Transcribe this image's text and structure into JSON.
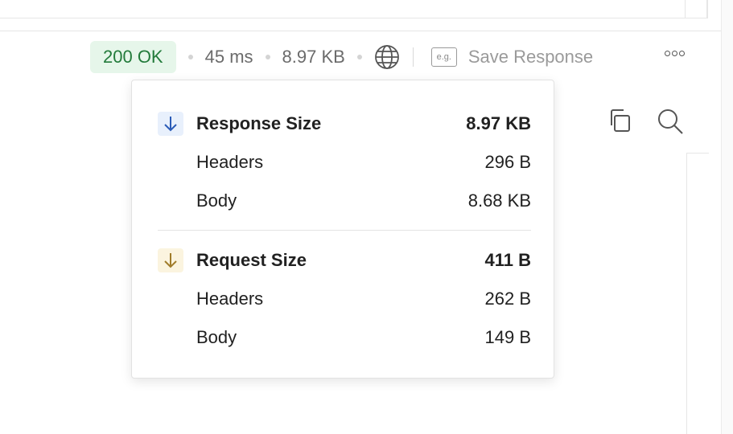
{
  "status": {
    "code_text": "200 OK",
    "time": "45 ms",
    "size": "8.97 KB"
  },
  "save_response": {
    "icon_text": "e.g.",
    "label": "Save Response"
  },
  "colors": {
    "success_bg": "#e6f6ea",
    "success_text": "#237b3b",
    "response_icon": "#2a5bb7",
    "request_icon": "#a07c2a"
  },
  "popover": {
    "response": {
      "title": "Response Size",
      "total": "8.97 KB",
      "headers_label": "Headers",
      "headers_value": "296 B",
      "body_label": "Body",
      "body_value": "8.68 KB"
    },
    "request": {
      "title": "Request Size",
      "total": "411 B",
      "headers_label": "Headers",
      "headers_value": "262 B",
      "body_label": "Body",
      "body_value": "149 B"
    }
  },
  "icons": {
    "network": "globe-icon",
    "more": "more-icon",
    "copy": "copy-icon",
    "search": "search-icon"
  }
}
